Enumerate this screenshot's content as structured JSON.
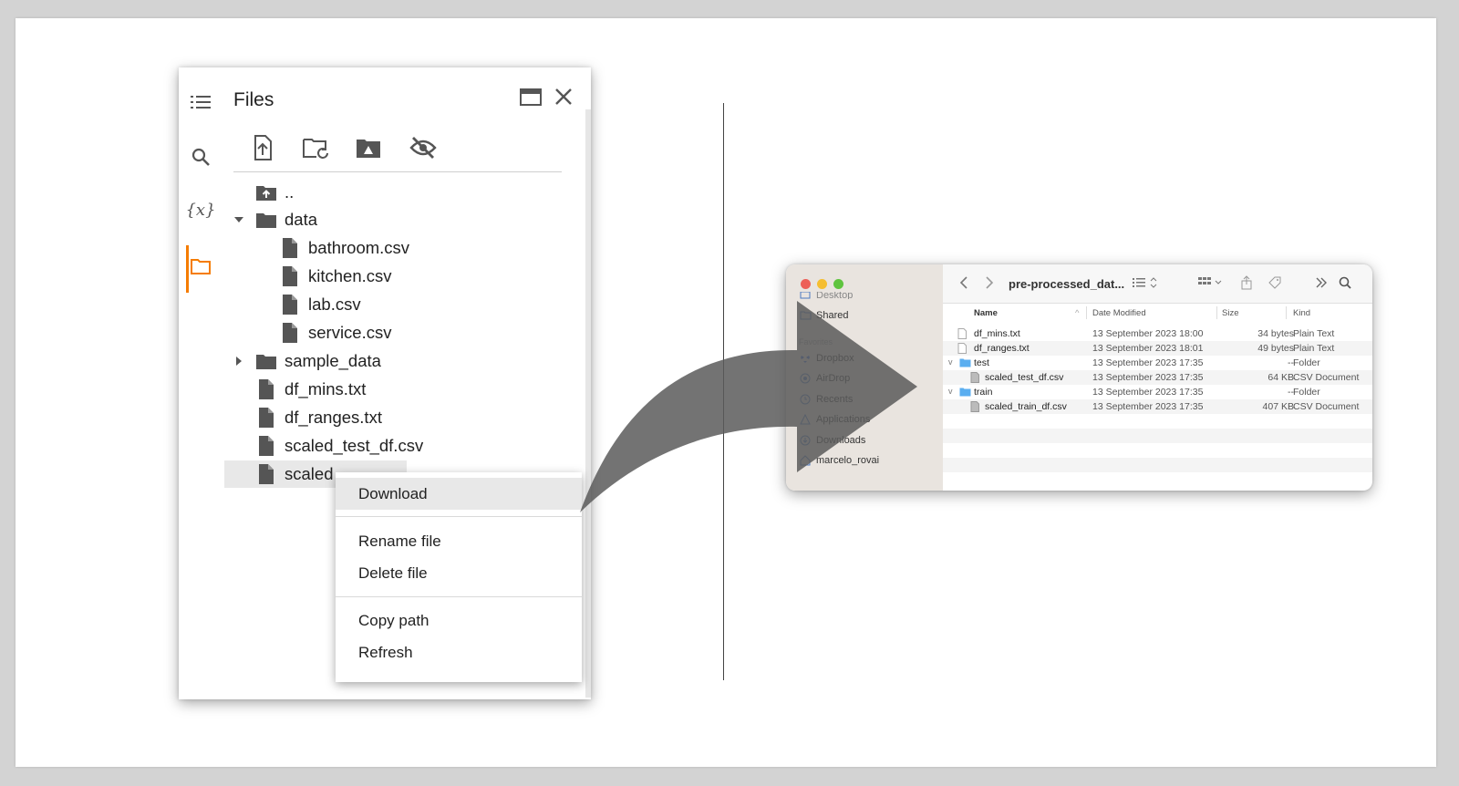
{
  "colab": {
    "title": "Files",
    "tree": [
      {
        "name": "..",
        "kind": "parent"
      },
      {
        "name": "data",
        "kind": "folder-open"
      },
      {
        "name": "bathroom.csv",
        "kind": "file"
      },
      {
        "name": "kitchen.csv",
        "kind": "file"
      },
      {
        "name": "lab.csv",
        "kind": "file"
      },
      {
        "name": "service.csv",
        "kind": "file"
      },
      {
        "name": "sample_data",
        "kind": "folder-closed"
      },
      {
        "name": "df_mins.txt",
        "kind": "file"
      },
      {
        "name": "df_ranges.txt",
        "kind": "file"
      },
      {
        "name": "scaled_test_df.csv",
        "kind": "file"
      },
      {
        "name": "scaled",
        "kind": "file-selected"
      }
    ],
    "context_menu": [
      "Download",
      "Rename file",
      "Delete file",
      "Copy path",
      "Refresh"
    ],
    "accent_color": "#f57c00"
  },
  "finder": {
    "title": "pre-processed_dat...",
    "sidebar": {
      "cut_top": "Desktop",
      "shared": "Shared",
      "section": "Favorites",
      "items": [
        "Dropbox",
        "AirDrop",
        "Recents",
        "Applications",
        "Downloads",
        "marcelo_rovai"
      ]
    },
    "columns": [
      "Name",
      "Date Modified",
      "Size",
      "Kind"
    ],
    "rows": [
      {
        "name": "df_mins.txt",
        "date": "13 September 2023 18:00",
        "size": "34 bytes",
        "kind": "Plain Text",
        "type": "file",
        "indent": 0
      },
      {
        "name": "df_ranges.txt",
        "date": "13 September 2023 18:01",
        "size": "49 bytes",
        "kind": "Plain Text",
        "type": "file",
        "indent": 0
      },
      {
        "name": "test",
        "date": "13 September 2023 17:35",
        "size": "--",
        "kind": "Folder",
        "type": "folder",
        "indent": 0
      },
      {
        "name": "scaled_test_df.csv",
        "date": "13 September 2023 17:35",
        "size": "64 KB",
        "kind": "CSV Document",
        "type": "file",
        "indent": 1
      },
      {
        "name": "train",
        "date": "13 September 2023 17:35",
        "size": "--",
        "kind": "Folder",
        "type": "folder",
        "indent": 0
      },
      {
        "name": "scaled_train_df.csv",
        "date": "13 September 2023 17:35",
        "size": "407 KB",
        "kind": "CSV Document",
        "type": "file",
        "indent": 1
      }
    ]
  }
}
